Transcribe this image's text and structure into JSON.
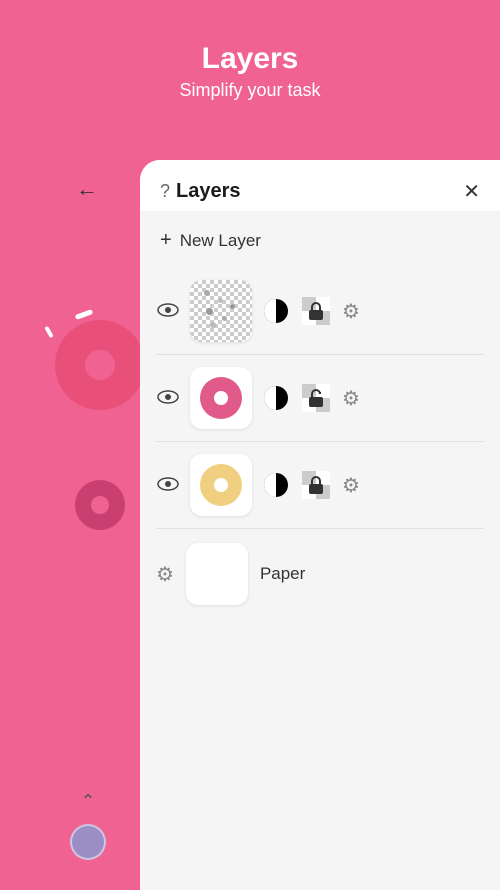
{
  "header": {
    "title": "Layers",
    "subtitle": "Simplify your task"
  },
  "panel": {
    "title": "Layers",
    "help_symbol": "?",
    "new_layer_label": "New Layer",
    "close_label": "×"
  },
  "layers": [
    {
      "id": "layer-1",
      "type": "scatter",
      "visible": true,
      "locked": false
    },
    {
      "id": "layer-2",
      "type": "donut-pink",
      "visible": true,
      "locked": true
    },
    {
      "id": "layer-3",
      "type": "donut-yellow",
      "visible": true,
      "locked": false
    },
    {
      "id": "paper",
      "type": "paper",
      "label": "Paper"
    }
  ],
  "sidebar": {
    "back_label": "←",
    "color_value": "#9B8EC4"
  }
}
